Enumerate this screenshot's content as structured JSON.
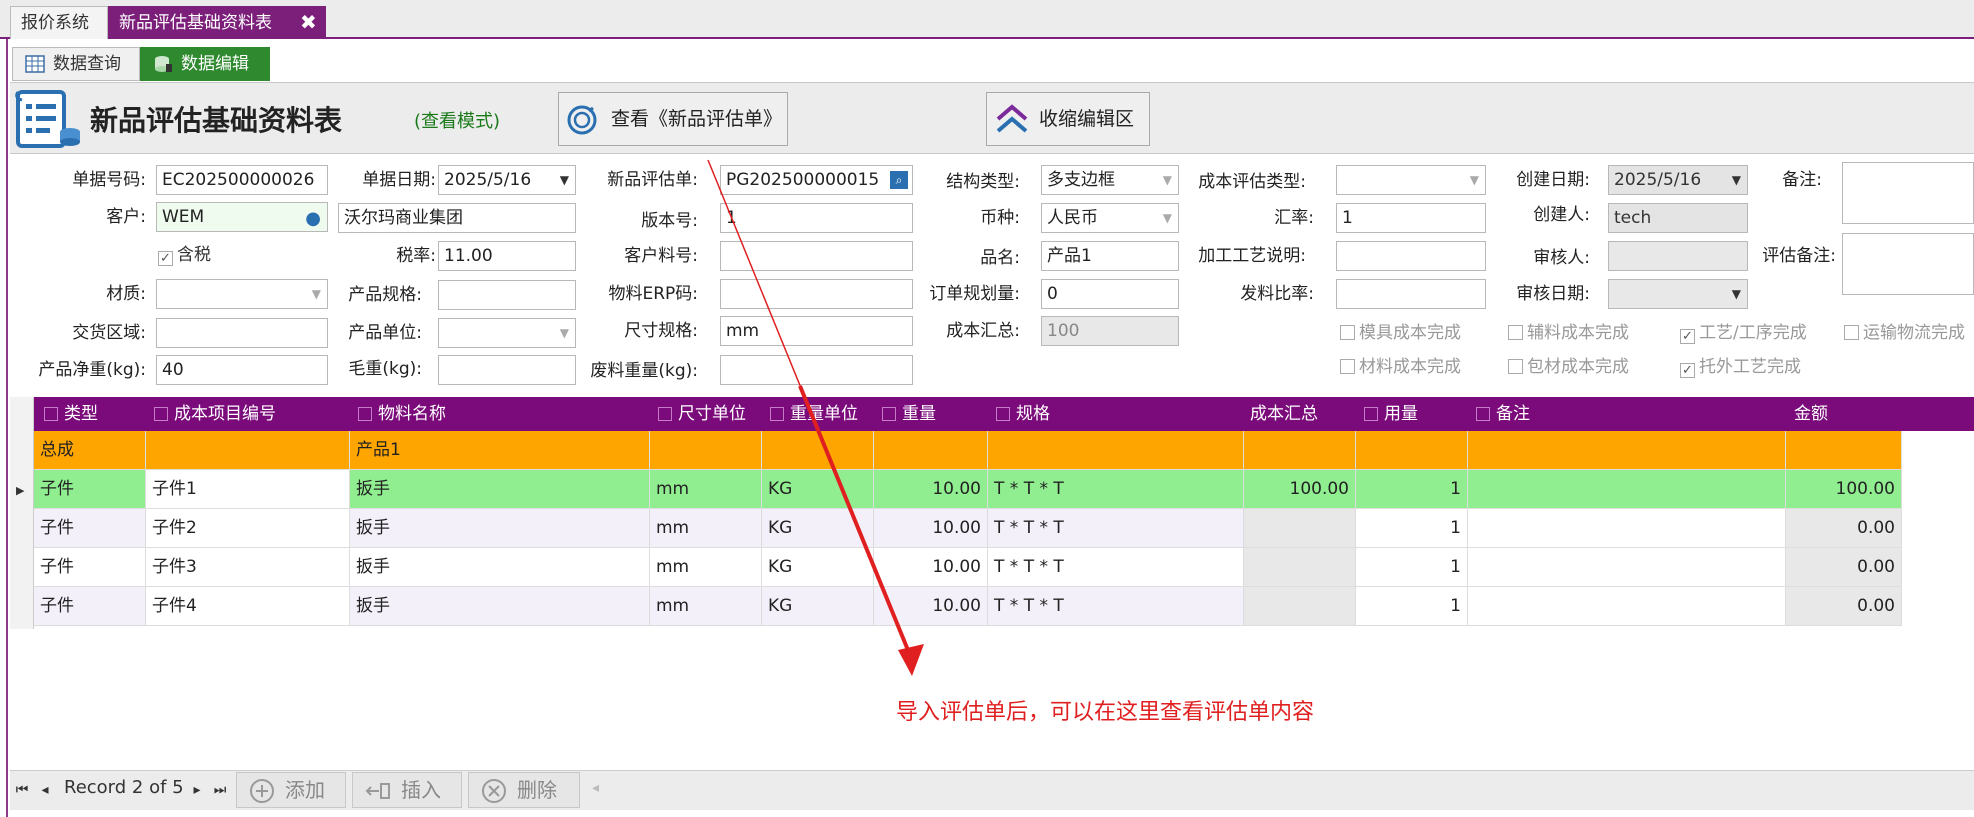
{
  "tabs": {
    "baojia": "报价系统",
    "xinpin": "新品评估基础资料表",
    "close": "✖"
  },
  "subtabs": {
    "query": "数据查询",
    "edit": "数据编辑"
  },
  "header": {
    "title": "新品评估基础资料表",
    "mode": "(查看模式)",
    "view_eval_button": "查看《新品评估单》",
    "collapse_button": "收缩编辑区"
  },
  "form": {
    "doc_no": {
      "label": "单据号码:",
      "value": "EC202500000026"
    },
    "doc_date": {
      "label": "单据日期:",
      "value": "2025/5/16"
    },
    "eval_no": {
      "label": "新品评估单:",
      "value": "PG202500000015"
    },
    "struct_type": {
      "label": "结构类型:",
      "value": "多支边框"
    },
    "cost_eval_type": {
      "label": "成本评估类型:",
      "value": ""
    },
    "create_date": {
      "label": "创建日期:",
      "value": "2025/5/16"
    },
    "remark": {
      "label": "备注:",
      "value": ""
    },
    "customer": {
      "label": "客户:",
      "code": "WEM",
      "name": "沃尔玛商业集团"
    },
    "version": {
      "label": "版本号:",
      "value": "1"
    },
    "currency": {
      "label": "币种:",
      "value": "人民币"
    },
    "rate": {
      "label": "汇率:",
      "value": "1"
    },
    "creator": {
      "label": "创建人:",
      "value": "tech"
    },
    "tax_included": {
      "label": "含税",
      "checked": true
    },
    "tax_rate": {
      "label": "税率:",
      "value": "11.00"
    },
    "cust_part": {
      "label": "客户料号:",
      "value": ""
    },
    "product_name": {
      "label": "品名:",
      "value": "产品1"
    },
    "process_desc": {
      "label": "加工工艺说明:",
      "value": ""
    },
    "reviewer": {
      "label": "审核人:",
      "value": ""
    },
    "eval_remark": {
      "label": "评估备注:",
      "value": ""
    },
    "material": {
      "label": "材质:",
      "value": ""
    },
    "product_spec": {
      "label": "产品规格:",
      "value": ""
    },
    "erp_code": {
      "label": "物料ERP码:",
      "value": ""
    },
    "order_qty": {
      "label": "订单规划量:",
      "value": "0"
    },
    "issue_ratio": {
      "label": "发料比率:",
      "value": ""
    },
    "review_date": {
      "label": "审核日期:",
      "value": ""
    },
    "delivery_area": {
      "label": "交货区域:",
      "value": ""
    },
    "product_unit": {
      "label": "产品单位:",
      "value": ""
    },
    "size_spec": {
      "label": "尺寸规格:",
      "value": "mm"
    },
    "cost_total": {
      "label": "成本汇总:",
      "value": "100"
    },
    "net_weight": {
      "label": "产品净重(kg):",
      "value": "40"
    },
    "gross_weight": {
      "label": "毛重(kg):",
      "value": ""
    },
    "scrap_weight": {
      "label": "废料重量(kg):",
      "value": ""
    }
  },
  "checks": [
    {
      "label": "模具成本完成",
      "checked": false
    },
    {
      "label": "辅料成本完成",
      "checked": false
    },
    {
      "label": "工艺/工序完成",
      "checked": true
    },
    {
      "label": "运输物流完成",
      "checked": false
    },
    {
      "label": "材料成本完成",
      "checked": false
    },
    {
      "label": "包材成本完成",
      "checked": false
    },
    {
      "label": "托外工艺完成",
      "checked": true
    }
  ],
  "grid": {
    "columns": [
      "类型",
      "成本项目编号",
      "物料名称",
      "尺寸单位",
      "重量单位",
      "重量",
      "规格",
      "成本汇总",
      "用量",
      "备注",
      "金额"
    ],
    "rows": [
      [
        "总成",
        "",
        "产品1",
        "",
        "",
        "",
        "",
        "",
        "",
        "",
        ""
      ],
      [
        "子件",
        "子件1",
        "扳手",
        "mm",
        "KG",
        "10.00",
        "T * T * T",
        "100.00",
        "1",
        "",
        "100.00"
      ],
      [
        "子件",
        "子件2",
        "扳手",
        "mm",
        "KG",
        "10.00",
        "T * T * T",
        "",
        "1",
        "",
        "0.00"
      ],
      [
        "子件",
        "子件3",
        "扳手",
        "mm",
        "KG",
        "10.00",
        "T * T * T",
        "",
        "1",
        "",
        "0.00"
      ],
      [
        "子件",
        "子件4",
        "扳手",
        "mm",
        "KG",
        "10.00",
        "T * T * T",
        "",
        "1",
        "",
        "0.00"
      ]
    ]
  },
  "nav": {
    "record": "Record 2 of 5",
    "first": "⏮",
    "prev": "◂",
    "next": "▸",
    "last": "⏭",
    "add": "添加",
    "insert": "插入",
    "delete": "删除"
  },
  "annotation": "导入评估单后，可以在这里查看评估单内容",
  "colors": {
    "accent": "#7b0a7b",
    "summary_row": "#ffa500",
    "selected_row": "#90ee90",
    "annotation": "#e02020"
  }
}
